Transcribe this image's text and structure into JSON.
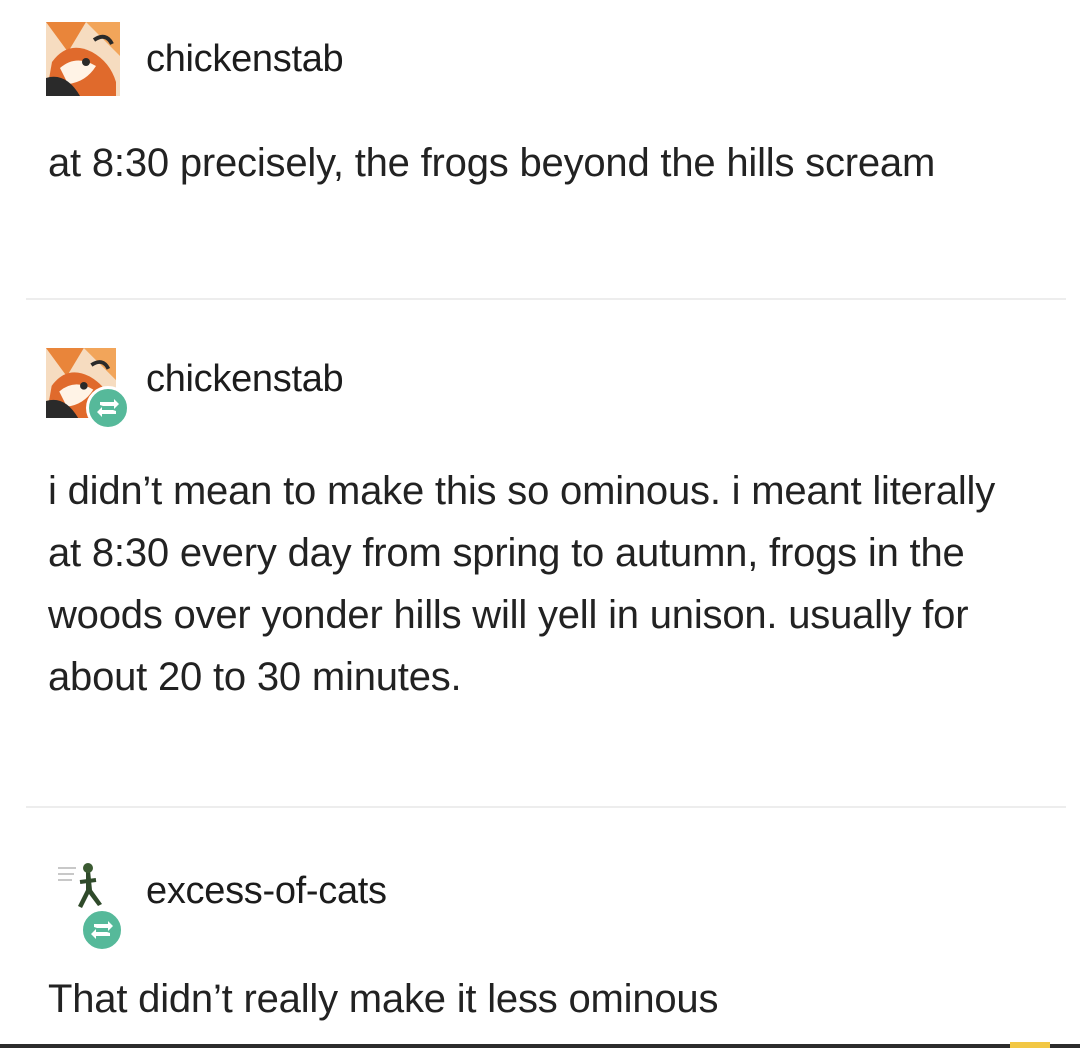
{
  "posts": [
    {
      "username": "chickenstab",
      "avatar_icon": "chickenstab-avatar-icon",
      "reblog": false,
      "body": "at 8:30 precisely, the frogs beyond the hills scream"
    },
    {
      "username": "chickenstab",
      "avatar_icon": "chickenstab-avatar-icon",
      "reblog": true,
      "reblog_icon": "reblog-icon",
      "body": "i didn’t mean to make this so ominous. i meant literally at 8:30 every day from spring to autumn, frogs in the woods over yonder hills will yell in unison. usually for about 20 to 30 minutes."
    },
    {
      "username": "excess-of-cats",
      "avatar_icon": "excess-of-cats-avatar-icon",
      "reblog": true,
      "reblog_icon": "reblog-icon",
      "body": "That didn’t really make it less ominous"
    }
  ],
  "colors": {
    "background": "#ffffff",
    "text": "#222222",
    "reblog_badge": "#56b99a",
    "avatar_orange": "#e9853a"
  }
}
